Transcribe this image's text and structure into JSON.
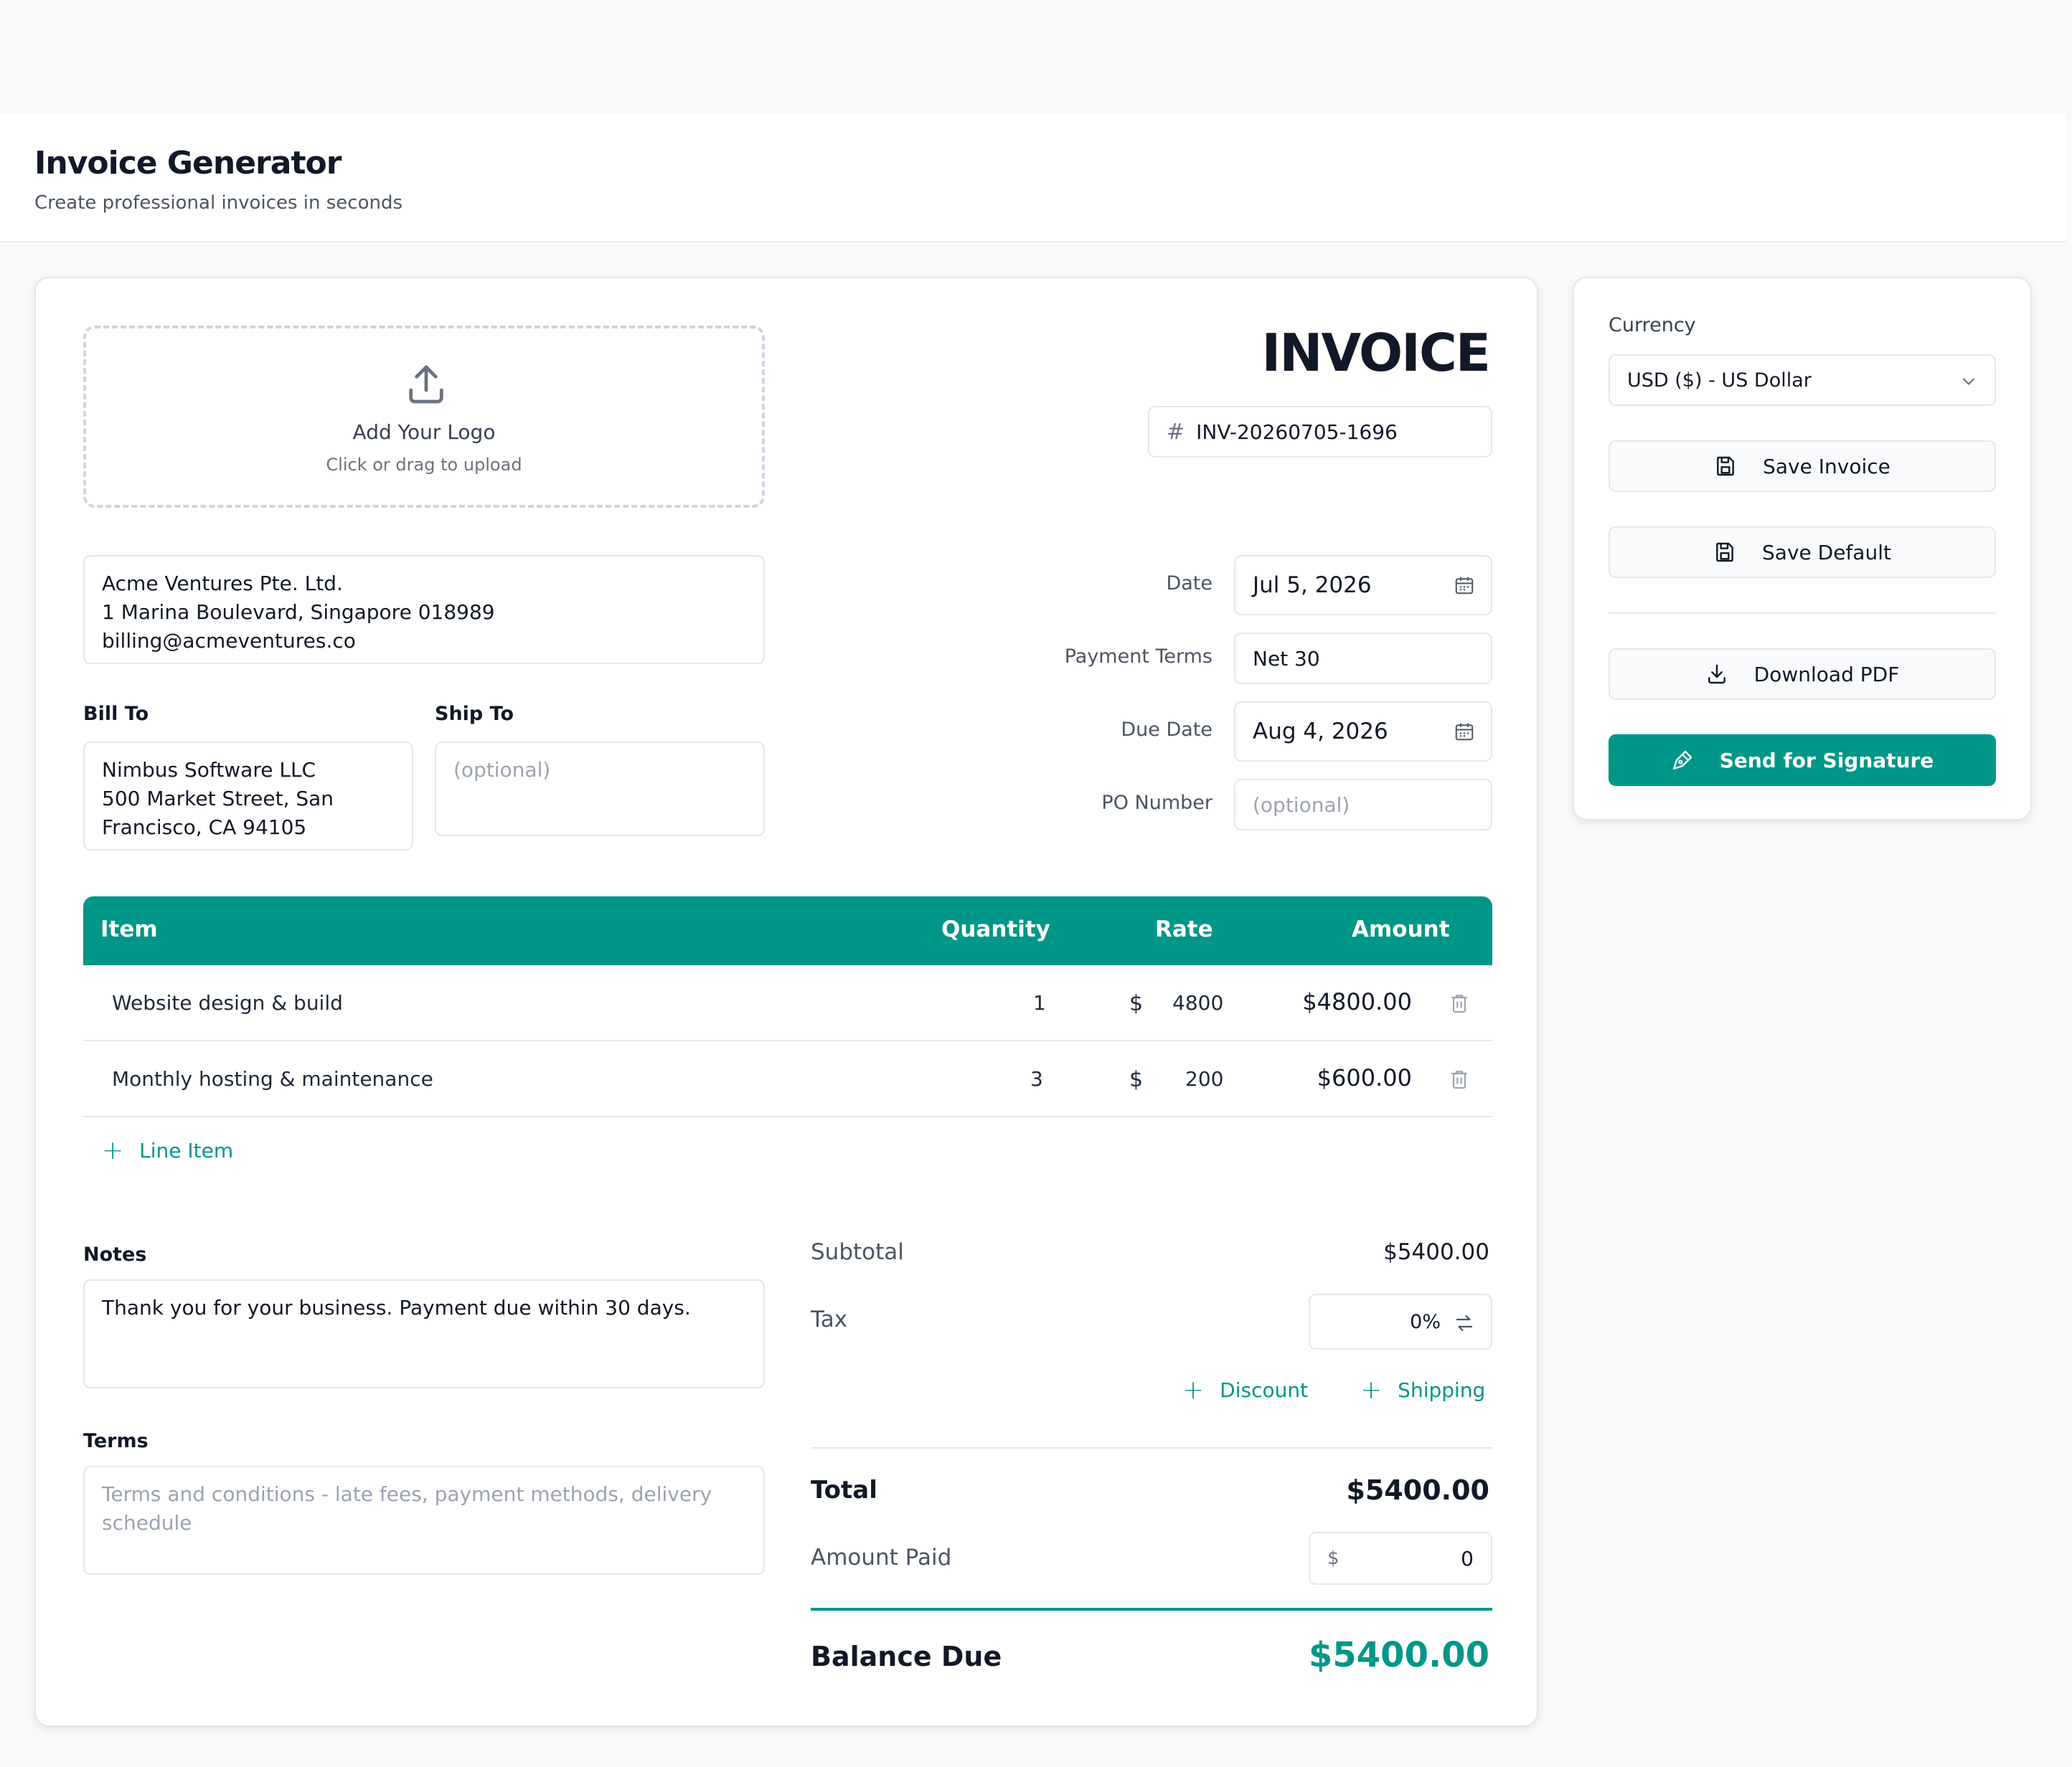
{
  "header": {
    "title": "Invoice Generator",
    "subtitle": "Create professional invoices in seconds"
  },
  "logo": {
    "label": "Add Your Logo",
    "hint": "Click or drag to upload"
  },
  "invoice": {
    "heading": "INVOICE",
    "number": "INV-20260705-1696"
  },
  "from": {
    "line1": "Acme Ventures Pte. Ltd.",
    "line2": "1 Marina Boulevard, Singapore 018989",
    "line3": "billing@acmeventures.co"
  },
  "bill_to": {
    "label": "Bill To",
    "line1": "Nimbus Software LLC",
    "line2": "500 Market Street, San",
    "line3": "Francisco, CA 94105"
  },
  "ship_to": {
    "label": "Ship To",
    "placeholder": "(optional)"
  },
  "meta": {
    "date_label": "Date",
    "date_value": "Jul 5, 2026",
    "terms_label": "Payment Terms",
    "terms_value": "Net 30",
    "due_label": "Due Date",
    "due_value": "Aug 4, 2026",
    "po_label": "PO Number",
    "po_placeholder": "(optional)"
  },
  "table": {
    "headers": {
      "item": "Item",
      "quantity": "Quantity",
      "rate": "Rate",
      "amount": "Amount"
    },
    "currency_symbol": "$",
    "rows": [
      {
        "item": "Website design & build",
        "quantity": "1",
        "rate": "4800",
        "amount": "$4800.00"
      },
      {
        "item": "Monthly hosting & maintenance",
        "quantity": "3",
        "rate": "200",
        "amount": "$600.00"
      }
    ],
    "add_line_label": "Line Item"
  },
  "notes": {
    "label": "Notes",
    "value": "Thank you for your business. Payment due within 30 days."
  },
  "terms": {
    "label": "Terms",
    "placeholder": "Terms and conditions - late fees, payment methods, delivery schedule"
  },
  "summary": {
    "subtotal_label": "Subtotal",
    "subtotal_value": "$5400.00",
    "tax_label": "Tax",
    "tax_value": "0%",
    "discount_label": "Discount",
    "shipping_label": "Shipping",
    "total_label": "Total",
    "total_value": "$5400.00",
    "paid_label": "Amount Paid",
    "paid_currency": "$",
    "paid_value": "0",
    "balance_label": "Balance Due",
    "balance_value": "$5400.00"
  },
  "sidebar": {
    "currency_label": "Currency",
    "currency_value": "USD ($) - US Dollar",
    "save_invoice": "Save Invoice",
    "save_default": "Save Default",
    "download_pdf": "Download PDF",
    "send_signature": "Send for Signature"
  },
  "colors": {
    "accent": "#009688",
    "background": "#f8f9fb"
  }
}
